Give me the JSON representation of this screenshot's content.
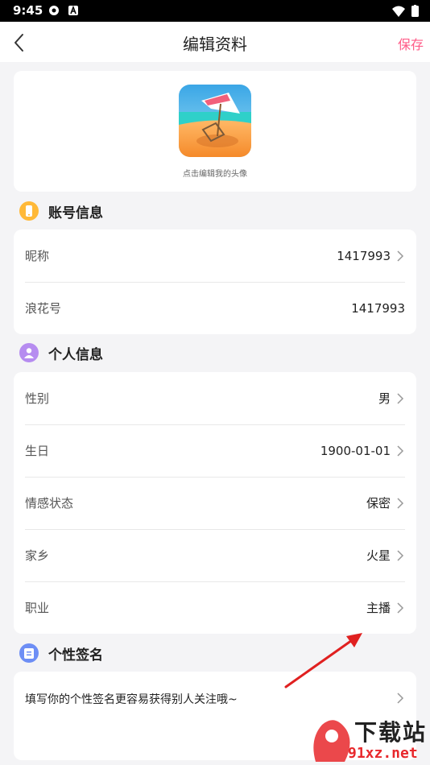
{
  "status_bar": {
    "time": "9:45"
  },
  "header": {
    "title": "编辑资料",
    "save_label": "保存"
  },
  "avatar": {
    "hint": "点击编辑我的头像"
  },
  "account_section": {
    "title": "账号信息",
    "rows": [
      {
        "label": "昵称",
        "value": "1417993"
      },
      {
        "label": "浪花号",
        "value": "1417993"
      }
    ]
  },
  "personal_section": {
    "title": "个人信息",
    "rows": [
      {
        "label": "性别",
        "value": "男"
      },
      {
        "label": "生日",
        "value": "1900-01-01"
      },
      {
        "label": "情感状态",
        "value": "保密"
      },
      {
        "label": "家乡",
        "value": "火星"
      },
      {
        "label": "职业",
        "value": "主播"
      }
    ]
  },
  "signature_section": {
    "title": "个性签名",
    "placeholder": "填写你的个性签名更容易获得别人关注哦~"
  },
  "watermark": {
    "title": "下载站",
    "url": "91xz.net"
  },
  "colors": {
    "accent": "#ff5b87",
    "account_badge": "#ffb938",
    "personal_badge": "#b68cf0",
    "signature_badge": "#6d8ef5",
    "arrow": "#e02020"
  }
}
